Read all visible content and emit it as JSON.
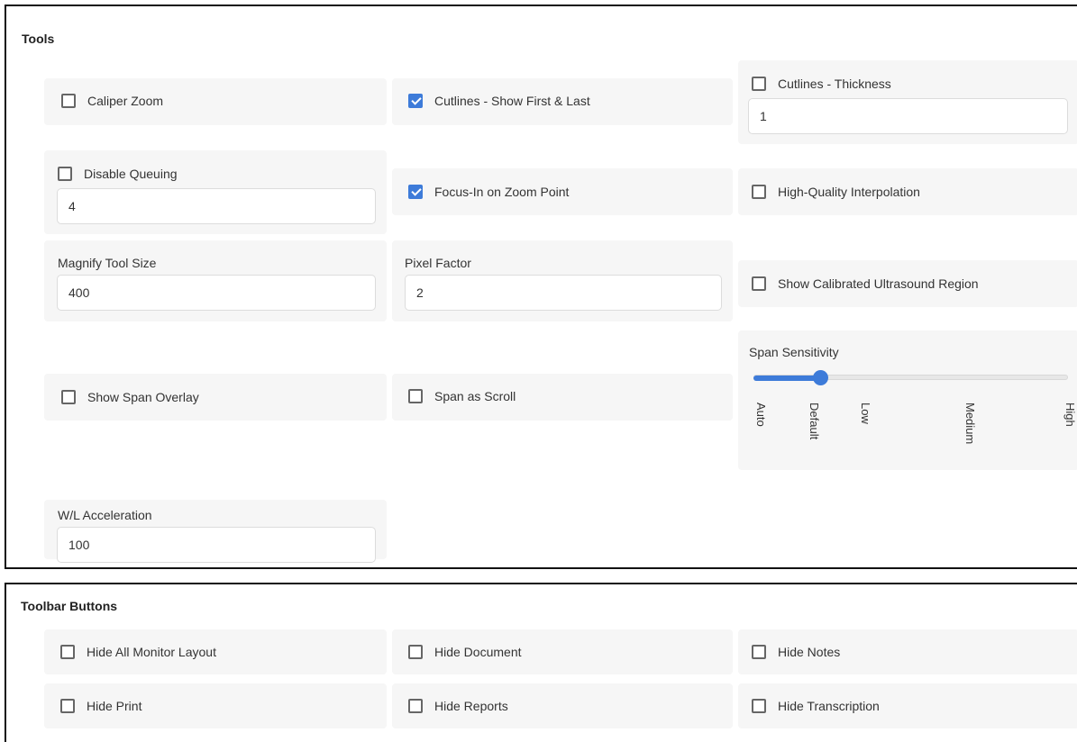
{
  "tools": {
    "title": "Tools",
    "caliper_zoom": {
      "label": "Caliper Zoom",
      "checked": false
    },
    "cutlines_first_last": {
      "label": "Cutlines - Show First & Last",
      "checked": true
    },
    "cutlines_thickness": {
      "label": "Cutlines - Thickness",
      "checked": false,
      "value": "1"
    },
    "disable_queuing": {
      "label": "Disable Queuing",
      "checked": false,
      "value": "4"
    },
    "focus_in_zoom": {
      "label": "Focus-In on Zoom Point",
      "checked": true
    },
    "hq_interpolation": {
      "label": "High-Quality Interpolation",
      "checked": false
    },
    "magnify_tool_size": {
      "label": "Magnify Tool Size",
      "value": "400"
    },
    "pixel_factor": {
      "label": "Pixel Factor",
      "value": "2"
    },
    "show_calibrated_us": {
      "label": "Show Calibrated Ultrasound Region",
      "checked": false
    },
    "span_sensitivity": {
      "label": "Span Sensitivity",
      "ticks": [
        "Auto",
        "Default",
        "Low",
        "Medium",
        "High"
      ],
      "selected": "Default",
      "accent": "#3d7bd9"
    },
    "show_span_overlay": {
      "label": "Show Span Overlay",
      "checked": false
    },
    "span_as_scroll": {
      "label": "Span as Scroll",
      "checked": false
    },
    "wl_acceleration": {
      "label": "W/L Acceleration",
      "value": "100"
    }
  },
  "toolbar": {
    "title": "Toolbar Buttons",
    "hide_all_monitor": {
      "label": "Hide All Monitor Layout",
      "checked": false
    },
    "hide_document": {
      "label": "Hide Document",
      "checked": false
    },
    "hide_notes": {
      "label": "Hide Notes",
      "checked": false
    },
    "hide_print": {
      "label": "Hide Print",
      "checked": false
    },
    "hide_reports": {
      "label": "Hide Reports",
      "checked": false
    },
    "hide_transcription": {
      "label": "Hide Transcription",
      "checked": false
    }
  }
}
